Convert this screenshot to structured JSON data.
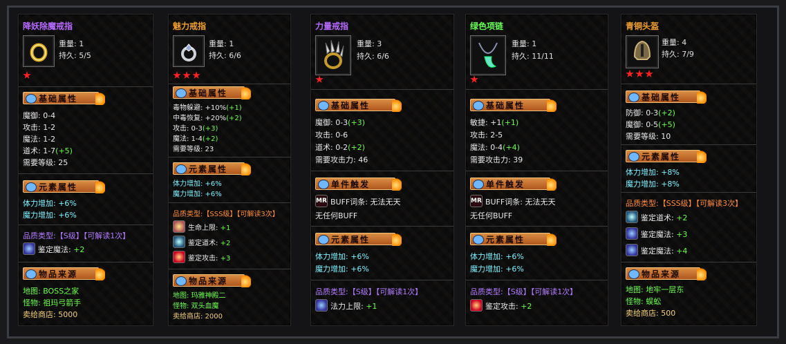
{
  "items": [
    {
      "title": "降妖除魔戒指",
      "icon": "ring-icon",
      "weight": "重量: 1",
      "durability": "持久: 5/5",
      "stars": 1,
      "section_basic": "基础属性",
      "basic": [
        "魔御: 0-4",
        "攻击: 1-2",
        "魔法: 1-2",
        "道术: 1-7",
        "(+5)",
        "需要等级: 25"
      ],
      "section_element": "元素属性",
      "element": [
        "体力增加: +6%",
        "魔力增加: +6%"
      ],
      "quality": "品质类型:【S级】【可解读1次】",
      "quality_items": [
        {
          "icon": "appraise-magic-icon",
          "label": "鉴定魔法:",
          "value": "+2"
        }
      ],
      "section_source": "物品来源",
      "source": [
        "地图: BOSS之家",
        "怪物: 祖玛弓箭手",
        "卖给商店: 5000"
      ]
    },
    {
      "title": "魅力戒指",
      "icon": "ring-icon",
      "weight": "重量: 1",
      "durability": "持久: 6/6",
      "stars": 3,
      "section_basic": "基础属性",
      "basic": [
        "毒物躲避: +10%",
        "(+1)",
        "中毒恢复: +20%",
        "(+2)",
        "攻击: 0-3",
        "(+3)",
        "魔法: 1-4",
        "(+2)",
        "需要等级: 23"
      ],
      "section_element": "元素属性",
      "element": [
        "体力增加: +6%",
        "魔力增加: +6%"
      ],
      "quality": "品质类型:【SSS级】【可解读3次】",
      "quality_items": [
        {
          "icon": "hp-limit-icon",
          "label": "生命上限:",
          "value": "+1"
        },
        {
          "icon": "appraise-tao-icon",
          "label": "鉴定道术:",
          "value": "+2"
        },
        {
          "icon": "appraise-attack-icon",
          "label": "鉴定攻击:",
          "value": "+3"
        }
      ],
      "section_source": "物品来源",
      "source": [
        "地图: 玛雅神殿二",
        "怪物: 双头血魔",
        "卖给商店: 2000"
      ]
    },
    {
      "title": "力量戒指",
      "icon": "claw-ring-icon",
      "weight": "重量: 3",
      "durability": "持久: 6/6",
      "stars": 1,
      "section_basic": "基础属性",
      "basic": [
        "魔御: 0-3",
        "(+3)",
        "攻击: 0-6",
        "道术: 0-2",
        "(+2)",
        "需要攻击力: 46"
      ],
      "section_skill": "单件触发",
      "skill": [
        "BUFF词条: 无法无天",
        "无任何BUFF"
      ],
      "section_element": "元素属性",
      "element": [
        "体力增加: +6%",
        "魔力增加: +6%"
      ],
      "quality": "品质类型:【S级】【可解读1次】",
      "quality_items": [
        {
          "icon": "mp-limit-icon",
          "label": "法力上限:",
          "value": "+1"
        }
      ]
    },
    {
      "title": "绿色项链",
      "icon": "necklace-icon",
      "weight": "重量: 1",
      "durability": "持久: 11/11",
      "stars": 1,
      "section_basic": "基础属性",
      "basic": [
        "敏捷: +1",
        "(+1)",
        "攻击: 2-5",
        "魔法: 0-4",
        "(+4)",
        "需要攻击力: 39"
      ],
      "section_skill": "单件触发",
      "skill": [
        "BUFF词条: 无法无天",
        "无任何BUFF"
      ],
      "section_element": "元素属性",
      "element": [
        "体力增加: +6%",
        "魔力增加: +6%"
      ],
      "quality": "品质类型:【S级】【可解读1次】",
      "quality_items": [
        {
          "icon": "appraise-attack-icon",
          "label": "鉴定攻击:",
          "value": "+2"
        }
      ]
    },
    {
      "title": "青铜头盔",
      "icon": "helmet-icon",
      "weight": "重量: 4",
      "durability": "持久: 7/9",
      "stars": 3,
      "section_basic": "基础属性",
      "basic": [
        "防御: 0-3",
        "(+2)",
        "魔御: 0-5",
        "(+5)",
        "需要等级: 10"
      ],
      "section_element": "元素属性",
      "element": [
        "体力增加: +8%",
        "魔力增加: +8%"
      ],
      "quality": "品质类型:【SSS级】【可解读3次】",
      "quality_items": [
        {
          "icon": "appraise-tao-icon",
          "label": "鉴定道术:",
          "value": "+2"
        },
        {
          "icon": "appraise-magic-icon",
          "label": "鉴定魔法:",
          "value": "+3"
        },
        {
          "icon": "appraise-magic-icon",
          "label": "鉴定魔法:",
          "value": "+4"
        }
      ],
      "section_source": "物品来源",
      "source": [
        "地图: 地牢一层东",
        "怪物: 蜈蚣",
        "卖给商店: 500"
      ]
    }
  ]
}
